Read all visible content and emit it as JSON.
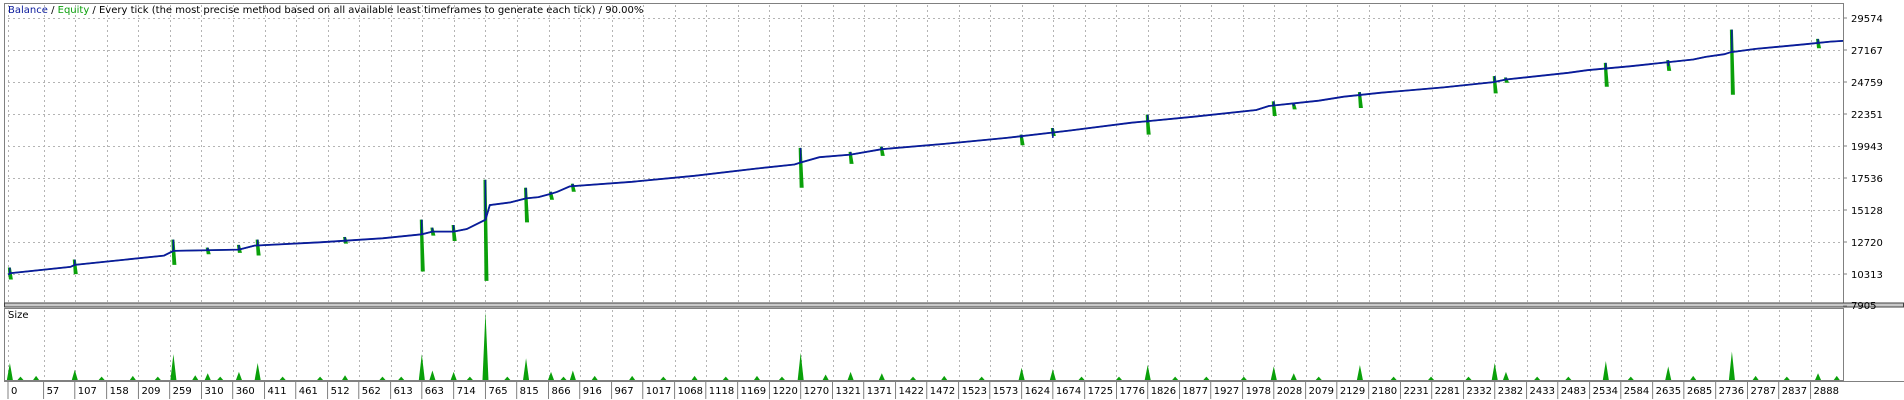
{
  "colors": {
    "background": "#ffffff",
    "grid": "#b4b4b4",
    "frame": "#808080",
    "balance": "#0a1a9c",
    "equity": "#0aa00a",
    "size": "#0aa00a",
    "text": "#000000",
    "separator": "#404040"
  },
  "chart_data": [
    {
      "type": "line",
      "legend": {
        "balance": "Balance",
        "equity": "Equity",
        "model": "Every tick (the most precise method based on all available least timeframes to generate each tick)",
        "quality": "90.00%",
        "separator": " / "
      },
      "y_ticks": [
        "29574",
        "27167",
        "24759",
        "22351",
        "19943",
        "17536",
        "15128",
        "12720",
        "10313",
        "7905"
      ],
      "y_tick_values": [
        29574,
        27167,
        24759,
        22351,
        19943,
        17536,
        15128,
        12720,
        10313,
        7905
      ],
      "ylim": [
        7905,
        29574
      ],
      "xlim": [
        0,
        2940
      ],
      "grid": true,
      "series": [
        {
          "name": "Balance",
          "x": [
            0,
            5,
            100,
            107,
            250,
            265,
            370,
            395,
            500,
            600,
            663,
            680,
            714,
            735,
            765,
            772,
            805,
            830,
            850,
            870,
            880,
            900,
            1000,
            1100,
            1200,
            1260,
            1270,
            1300,
            1350,
            1400,
            1500,
            1600,
            1700,
            1800,
            1900,
            2000,
            2020,
            2100,
            2140,
            2200,
            2300,
            2380,
            2400,
            2500,
            2530,
            2600,
            2700,
            2720,
            2750,
            2760,
            2800,
            2880,
            2920,
            2940
          ],
          "values": [
            10280,
            10380,
            10850,
            11000,
            11700,
            12050,
            12150,
            12450,
            12700,
            13000,
            13300,
            13500,
            13500,
            13700,
            14400,
            15500,
            15700,
            16000,
            16100,
            16350,
            16500,
            16900,
            17250,
            17700,
            18250,
            18550,
            18700,
            19100,
            19300,
            19700,
            20100,
            20550,
            21100,
            21700,
            22150,
            22650,
            22950,
            23350,
            23650,
            23950,
            24350,
            24750,
            24950,
            25450,
            25650,
            25950,
            26450,
            26650,
            26850,
            27000,
            27250,
            27600,
            27800,
            27850
          ]
        },
        {
          "name": "Equity",
          "x": [
            0,
            5,
            100,
            107,
            250,
            265,
            370,
            395,
            500,
            600,
            663,
            680,
            714,
            735,
            765,
            772,
            805,
            830,
            850,
            870,
            880,
            900,
            1000,
            1100,
            1200,
            1260,
            1270,
            1300,
            1350,
            1400,
            1500,
            1600,
            1700,
            1800,
            1900,
            2000,
            2020,
            2100,
            2140,
            2200,
            2300,
            2380,
            2400,
            2500,
            2530,
            2600,
            2700,
            2720,
            2750,
            2760,
            2800,
            2880,
            2920,
            2940
          ],
          "values": [
            10280,
            10380,
            10850,
            11000,
            11700,
            12050,
            12150,
            12450,
            12700,
            13000,
            13300,
            13500,
            13500,
            13700,
            14400,
            15500,
            15700,
            16000,
            16100,
            16350,
            16500,
            16900,
            17250,
            17700,
            18250,
            18550,
            18700,
            19100,
            19300,
            19700,
            20100,
            20550,
            21100,
            21700,
            22150,
            22650,
            22950,
            23350,
            23650,
            23950,
            24350,
            24750,
            24950,
            25450,
            25650,
            25950,
            26450,
            26650,
            26850,
            27000,
            27250,
            27600,
            27800,
            27850
          ],
          "spikes": [
            {
              "x": 3,
              "down": 9900,
              "up": 10800
            },
            {
              "x": 107,
              "down": 10300,
              "up": 11400
            },
            {
              "x": 265,
              "down": 11000,
              "up": 12900
            },
            {
              "x": 320,
              "down": 11800,
              "up": 12300
            },
            {
              "x": 370,
              "down": 11900,
              "up": 12500
            },
            {
              "x": 400,
              "down": 11700,
              "up": 12900
            },
            {
              "x": 540,
              "down": 12600,
              "up": 13100
            },
            {
              "x": 663,
              "down": 10500,
              "up": 14400
            },
            {
              "x": 680,
              "down": 13200,
              "up": 13800
            },
            {
              "x": 714,
              "down": 12800,
              "up": 14000
            },
            {
              "x": 765,
              "down": 9800,
              "up": 17400
            },
            {
              "x": 830,
              "down": 14200,
              "up": 16800
            },
            {
              "x": 870,
              "down": 15900,
              "up": 16500
            },
            {
              "x": 905,
              "down": 16500,
              "up": 17100
            },
            {
              "x": 1270,
              "down": 16800,
              "up": 19800
            },
            {
              "x": 1350,
              "down": 18600,
              "up": 19500
            },
            {
              "x": 1400,
              "down": 19200,
              "up": 19900
            },
            {
              "x": 1624,
              "down": 20000,
              "up": 20800
            },
            {
              "x": 1674,
              "down": 20700,
              "up": 21300
            },
            {
              "x": 1826,
              "down": 20800,
              "up": 22300
            },
            {
              "x": 2028,
              "down": 22200,
              "up": 23300
            },
            {
              "x": 2060,
              "down": 22700,
              "up": 23200
            },
            {
              "x": 2166,
              "down": 22800,
              "up": 24000
            },
            {
              "x": 2382,
              "down": 23900,
              "up": 25200
            },
            {
              "x": 2400,
              "down": 24700,
              "up": 25100
            },
            {
              "x": 2560,
              "down": 24400,
              "up": 26200
            },
            {
              "x": 2660,
              "down": 25600,
              "up": 26400
            },
            {
              "x": 2762,
              "down": 23800,
              "up": 28700
            },
            {
              "x": 2900,
              "down": 27300,
              "up": 28000
            }
          ]
        }
      ]
    },
    {
      "type": "bar",
      "label": "Size",
      "x_ticks": [
        "0",
        "57",
        "107",
        "158",
        "209",
        "259",
        "310",
        "360",
        "411",
        "461",
        "512",
        "562",
        "613",
        "663",
        "714",
        "765",
        "815",
        "866",
        "916",
        "967",
        "1017",
        "1068",
        "1118",
        "1169",
        "1220",
        "1270",
        "1321",
        "1371",
        "1422",
        "1472",
        "1523",
        "1573",
        "1624",
        "1674",
        "1725",
        "1776",
        "1826",
        "1877",
        "1927",
        "1978",
        "2028",
        "2079",
        "2129",
        "2180",
        "2231",
        "2281",
        "2332",
        "2382",
        "2433",
        "2483",
        "2534",
        "2584",
        "2635",
        "2685",
        "2736",
        "2787",
        "2837",
        "2888"
      ],
      "x_tick_values": [
        0,
        57,
        107,
        158,
        209,
        259,
        310,
        360,
        411,
        461,
        512,
        562,
        613,
        663,
        714,
        765,
        815,
        866,
        916,
        967,
        1017,
        1068,
        1118,
        1169,
        1220,
        1270,
        1321,
        1371,
        1422,
        1472,
        1523,
        1573,
        1624,
        1674,
        1725,
        1776,
        1826,
        1877,
        1927,
        1978,
        2028,
        2079,
        2129,
        2180,
        2231,
        2281,
        2332,
        2382,
        2433,
        2483,
        2534,
        2584,
        2635,
        2685,
        2736,
        2787,
        2837,
        2888
      ],
      "ylim": [
        0,
        1
      ],
      "x": [
        3,
        20,
        45,
        107,
        150,
        200,
        240,
        265,
        300,
        320,
        340,
        370,
        400,
        440,
        500,
        540,
        600,
        630,
        663,
        680,
        714,
        740,
        765,
        800,
        830,
        870,
        890,
        905,
        940,
        1000,
        1050,
        1100,
        1150,
        1200,
        1240,
        1270,
        1310,
        1350,
        1400,
        1450,
        1500,
        1560,
        1624,
        1674,
        1720,
        1780,
        1826,
        1870,
        1920,
        1980,
        2028,
        2060,
        2100,
        2166,
        2220,
        2280,
        2340,
        2382,
        2400,
        2450,
        2500,
        2560,
        2600,
        2660,
        2700,
        2762,
        2800,
        2850,
        2900,
        2930
      ],
      "values": [
        0.25,
        0.05,
        0.06,
        0.15,
        0.05,
        0.06,
        0.05,
        0.38,
        0.07,
        0.1,
        0.05,
        0.12,
        0.25,
        0.05,
        0.05,
        0.07,
        0.05,
        0.05,
        0.38,
        0.14,
        0.12,
        0.05,
        1.0,
        0.05,
        0.32,
        0.12,
        0.05,
        0.14,
        0.06,
        0.06,
        0.05,
        0.06,
        0.05,
        0.06,
        0.05,
        0.4,
        0.08,
        0.12,
        0.1,
        0.05,
        0.06,
        0.05,
        0.18,
        0.16,
        0.05,
        0.05,
        0.22,
        0.05,
        0.05,
        0.05,
        0.2,
        0.1,
        0.05,
        0.22,
        0.05,
        0.05,
        0.05,
        0.25,
        0.12,
        0.05,
        0.05,
        0.28,
        0.05,
        0.2,
        0.06,
        0.42,
        0.06,
        0.05,
        0.1,
        0.06
      ]
    }
  ]
}
